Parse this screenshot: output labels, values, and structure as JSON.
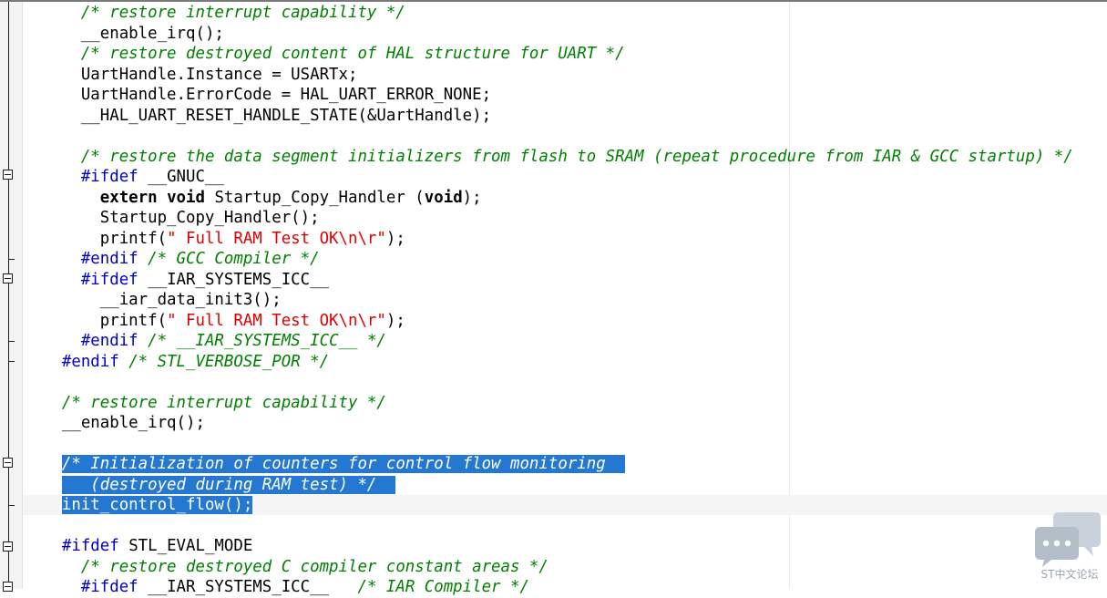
{
  "editor": {
    "lines": [
      {
        "id": "l1",
        "indent": "      ",
        "tokens": [
          {
            "t": "cmt",
            "v": "/* restore interrupt capability */"
          }
        ]
      },
      {
        "id": "l2",
        "indent": "      ",
        "tokens": [
          {
            "t": "txt",
            "v": "__enable_irq();"
          }
        ]
      },
      {
        "id": "l3",
        "indent": "      ",
        "tokens": [
          {
            "t": "cmt",
            "v": "/* restore destroyed content of HAL structure for UART */"
          }
        ]
      },
      {
        "id": "l4",
        "indent": "      ",
        "tokens": [
          {
            "t": "txt",
            "v": "UartHandle.Instance = USARTx;"
          }
        ]
      },
      {
        "id": "l5",
        "indent": "      ",
        "tokens": [
          {
            "t": "txt",
            "v": "UartHandle.ErrorCode = HAL_UART_ERROR_NONE;"
          }
        ]
      },
      {
        "id": "l6",
        "indent": "      ",
        "tokens": [
          {
            "t": "txt",
            "v": "__HAL_UART_RESET_HANDLE_STATE(&UartHandle);"
          }
        ]
      },
      {
        "id": "l7",
        "indent": "",
        "tokens": []
      },
      {
        "id": "l8",
        "indent": "      ",
        "tokens": [
          {
            "t": "cmt",
            "v": "/* restore the data segment initializers from flash to SRAM (repeat procedure from IAR & GCC startup) */"
          }
        ]
      },
      {
        "id": "l9",
        "indent": "      ",
        "tokens": [
          {
            "t": "pp",
            "v": "#ifdef"
          },
          {
            "t": "txt",
            "v": " __GNUC__"
          }
        ]
      },
      {
        "id": "l10",
        "indent": "        ",
        "tokens": [
          {
            "t": "kw",
            "v": "extern"
          },
          {
            "t": "txt",
            "v": " "
          },
          {
            "t": "kw",
            "v": "void"
          },
          {
            "t": "txt",
            "v": " Startup_Copy_Handler ("
          },
          {
            "t": "kw",
            "v": "void"
          },
          {
            "t": "txt",
            "v": ");"
          }
        ]
      },
      {
        "id": "l11",
        "indent": "        ",
        "tokens": [
          {
            "t": "txt",
            "v": "Startup_Copy_Handler();"
          }
        ]
      },
      {
        "id": "l12",
        "indent": "        ",
        "tokens": [
          {
            "t": "txt",
            "v": "printf("
          },
          {
            "t": "str",
            "v": "\" Full RAM Test OK\\n\\r\""
          },
          {
            "t": "txt",
            "v": ");"
          }
        ]
      },
      {
        "id": "l13",
        "indent": "      ",
        "tokens": [
          {
            "t": "pp",
            "v": "#endif"
          },
          {
            "t": "txt",
            "v": " "
          },
          {
            "t": "cmt",
            "v": "/* GCC Compiler */"
          }
        ]
      },
      {
        "id": "l14",
        "indent": "      ",
        "tokens": [
          {
            "t": "pp",
            "v": "#ifdef"
          },
          {
            "t": "txt",
            "v": " __IAR_SYSTEMS_ICC__"
          }
        ]
      },
      {
        "id": "l15",
        "indent": "        ",
        "tokens": [
          {
            "t": "txt",
            "v": "__iar_data_init3();"
          }
        ]
      },
      {
        "id": "l16",
        "indent": "        ",
        "tokens": [
          {
            "t": "txt",
            "v": "printf("
          },
          {
            "t": "str",
            "v": "\" Full RAM Test OK\\n\\r\""
          },
          {
            "t": "txt",
            "v": ");"
          }
        ]
      },
      {
        "id": "l17",
        "indent": "      ",
        "tokens": [
          {
            "t": "pp",
            "v": "#endif"
          },
          {
            "t": "txt",
            "v": " "
          },
          {
            "t": "cmt",
            "v": "/* __IAR_SYSTEMS_ICC__ */"
          }
        ]
      },
      {
        "id": "l18",
        "indent": "    ",
        "tokens": [
          {
            "t": "pp",
            "v": "#endif"
          },
          {
            "t": "txt",
            "v": " "
          },
          {
            "t": "cmt",
            "v": "/* STL_VERBOSE_POR */"
          }
        ]
      },
      {
        "id": "l19",
        "indent": "",
        "tokens": []
      },
      {
        "id": "l20",
        "indent": "    ",
        "tokens": [
          {
            "t": "cmt",
            "v": "/* restore interrupt capability */"
          }
        ]
      },
      {
        "id": "l21",
        "indent": "    ",
        "tokens": [
          {
            "t": "txt",
            "v": "__enable_irq();"
          }
        ]
      },
      {
        "id": "l22",
        "indent": "",
        "tokens": []
      },
      {
        "id": "l23",
        "indent": "    ",
        "selected": true,
        "tokens": [
          {
            "t": "cmt",
            "v": "/* Initialization of counters for control flow monitoring  "
          }
        ]
      },
      {
        "id": "l24",
        "indent": "    ",
        "selected": true,
        "tokens": [
          {
            "t": "cmt",
            "v": "   (destroyed during RAM test) */  "
          }
        ]
      },
      {
        "id": "l25",
        "indent": "    ",
        "selected": true,
        "tokens": [
          {
            "t": "txt",
            "v": "init_control_flow();"
          }
        ]
      },
      {
        "id": "l26",
        "indent": "",
        "tokens": []
      },
      {
        "id": "l27",
        "indent": "    ",
        "tokens": [
          {
            "t": "pp",
            "v": "#ifdef"
          },
          {
            "t": "txt",
            "v": " STL_EVAL_MODE"
          }
        ]
      },
      {
        "id": "l28",
        "indent": "      ",
        "tokens": [
          {
            "t": "cmt",
            "v": "/* restore destroyed C compiler constant areas */"
          }
        ]
      },
      {
        "id": "l29",
        "indent": "      ",
        "tokens": [
          {
            "t": "pp",
            "v": "#ifdef"
          },
          {
            "t": "txt",
            "v": " __IAR_SYSTEMS_ICC__   "
          },
          {
            "t": "cmt",
            "v": "/* IAR Compiler */"
          }
        ]
      }
    ]
  },
  "watermark": {
    "text": "ST中文论坛",
    "icon": "chat-bubbles-icon",
    "color": "#b4bec8"
  },
  "colors": {
    "comment": "#008000",
    "string": "#e00000",
    "preprocessor": "#0000c8",
    "selection": "#2478d2"
  }
}
